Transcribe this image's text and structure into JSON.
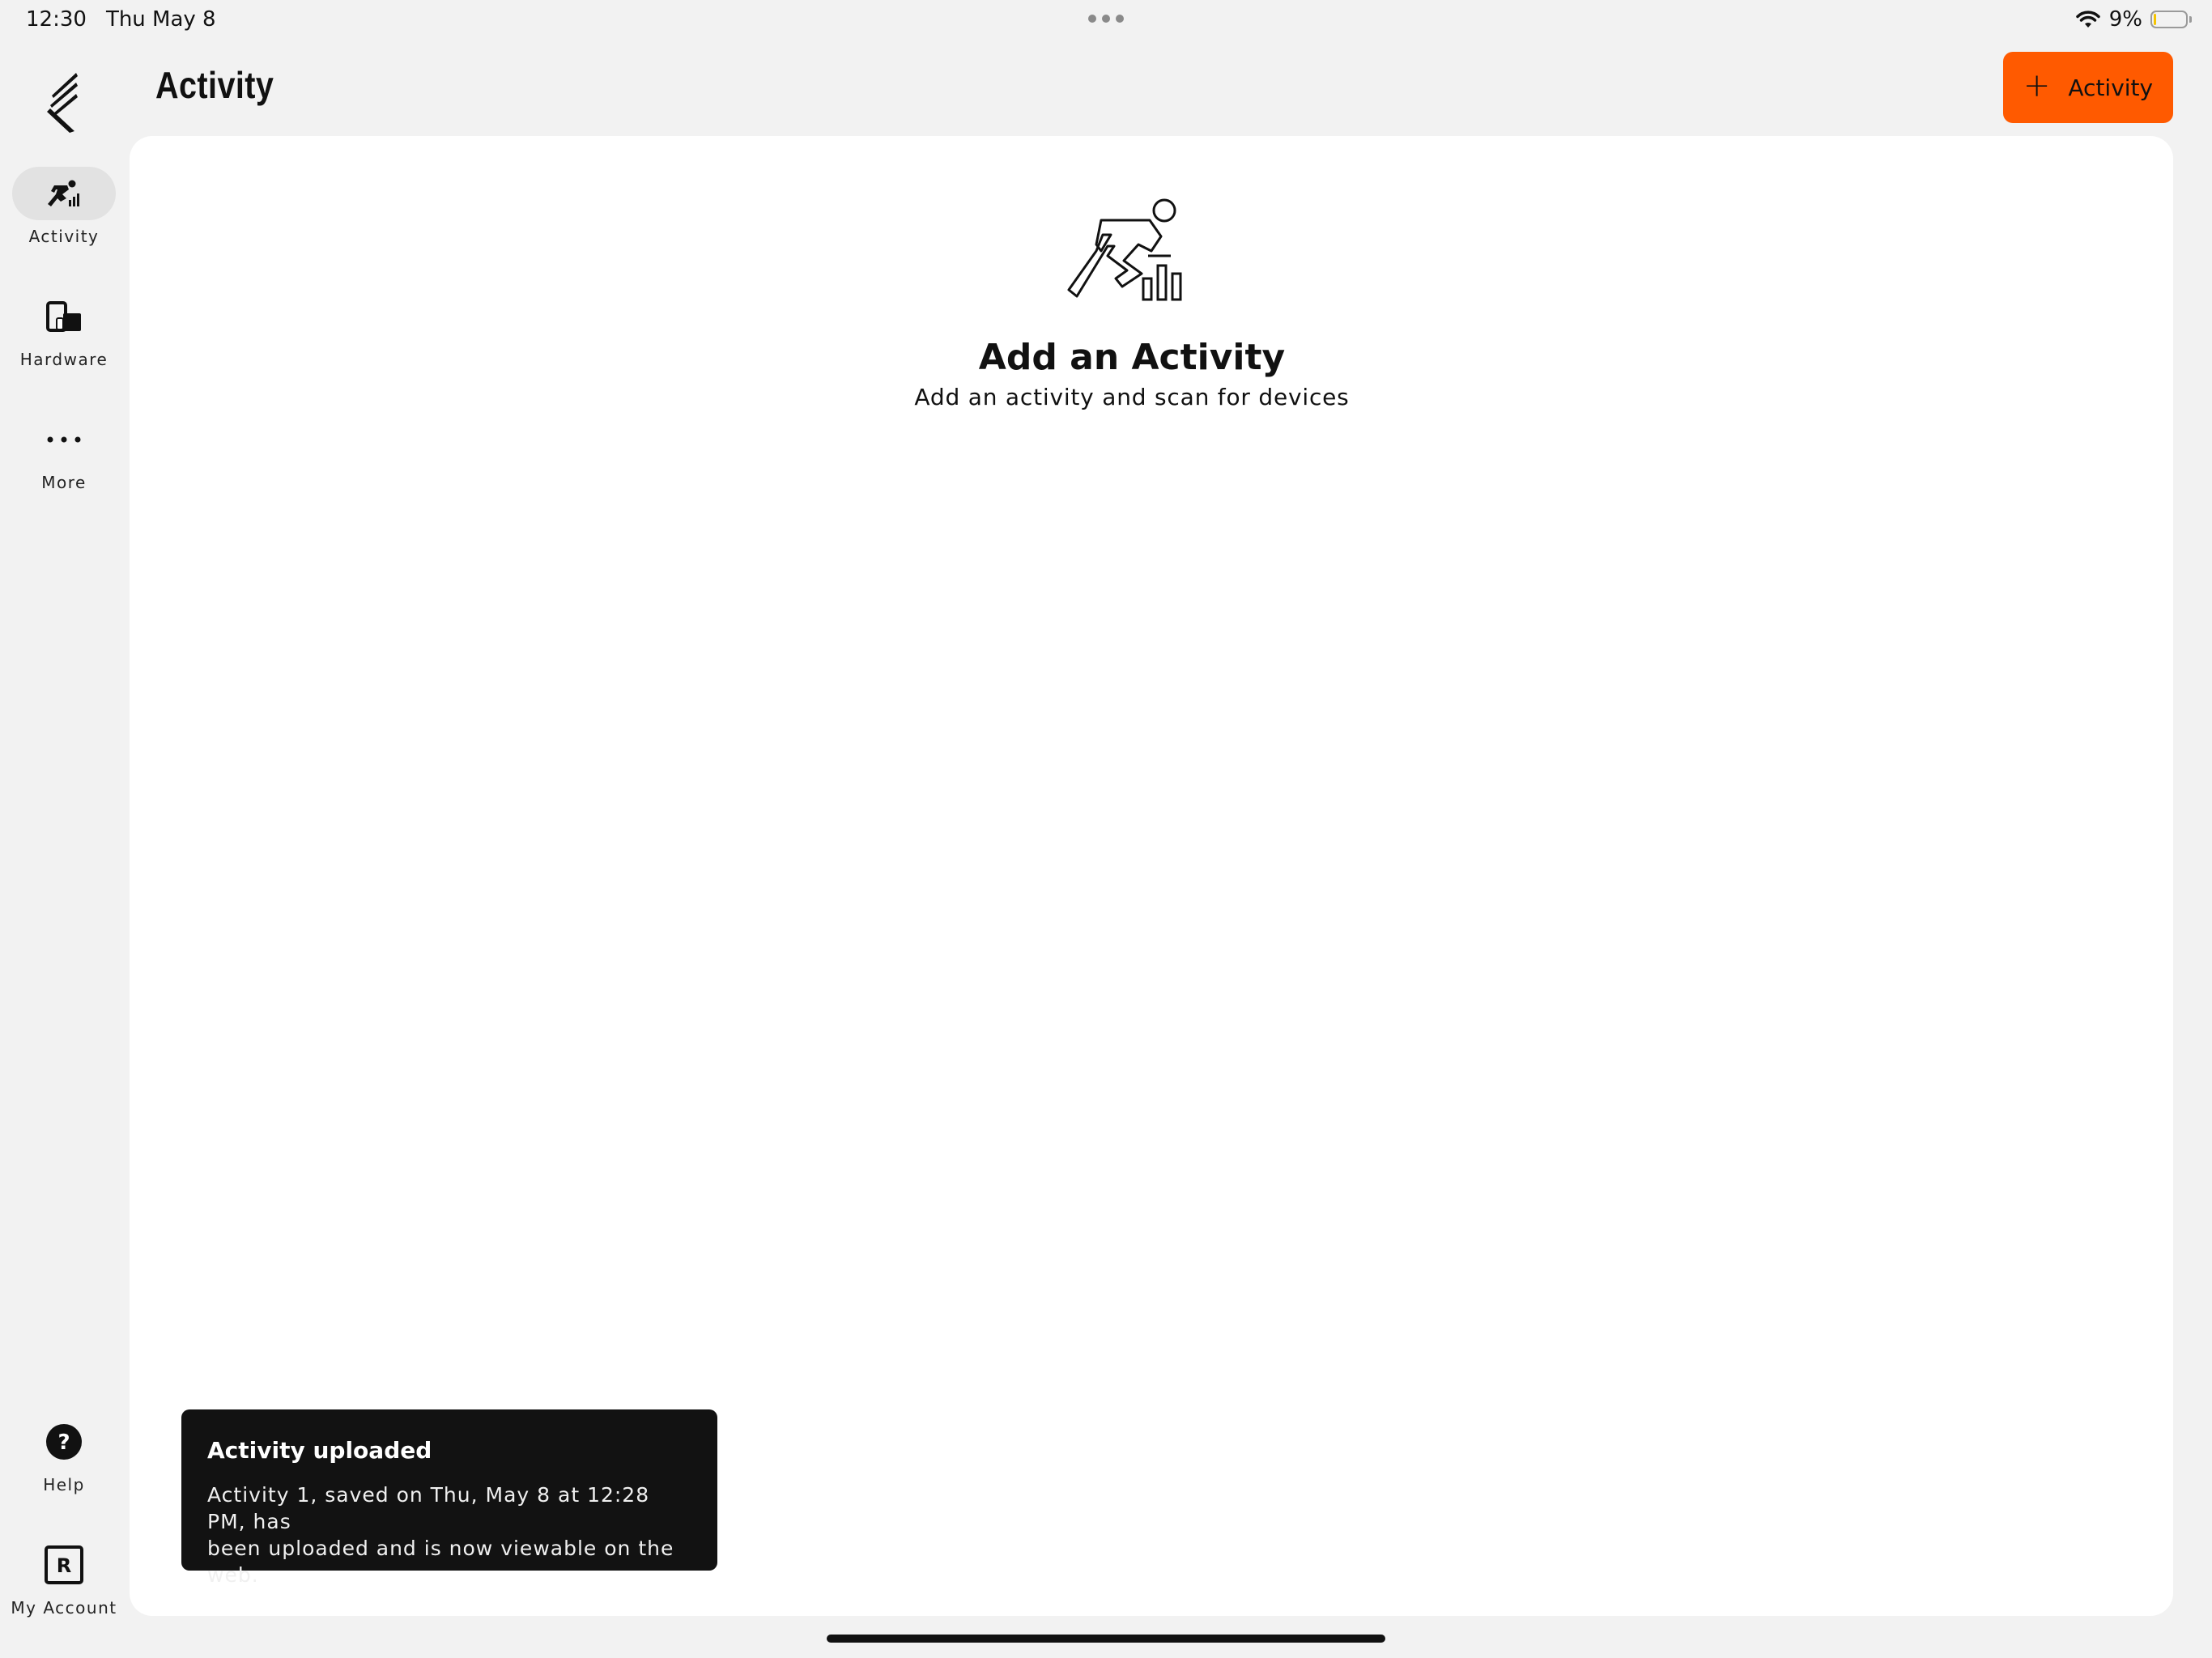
{
  "status_bar": {
    "time": "12:30",
    "date": "Thu May 8",
    "battery_percent": "9%",
    "battery_level": 0.09
  },
  "sidebar": {
    "items": [
      {
        "label": "Activity",
        "icon": "runner-chart-icon",
        "active": true
      },
      {
        "label": "Hardware",
        "icon": "devices-icon",
        "active": false
      },
      {
        "label": "More",
        "icon": "more-dots-icon",
        "active": false
      }
    ],
    "bottom_items": [
      {
        "label": "Help",
        "icon": "help-icon"
      },
      {
        "label": "My Account",
        "icon": "account-icon",
        "badge": "R"
      }
    ]
  },
  "header": {
    "title": "Activity",
    "add_button_label": "Activity"
  },
  "empty_state": {
    "icon": "runner-chart-icon",
    "title": "Add an Activity",
    "subtitle": "Add an activity and scan for devices"
  },
  "toast": {
    "title": "Activity uploaded",
    "line1": "Activity 1, saved on Thu, May 8 at 12:28 PM, has",
    "line2": "been uploaded and is now viewable on the web."
  },
  "colors": {
    "accent": "#ff5a00",
    "toast_bg": "#121212",
    "panel_bg": "#ffffff",
    "app_bg": "#f2f2f2"
  }
}
